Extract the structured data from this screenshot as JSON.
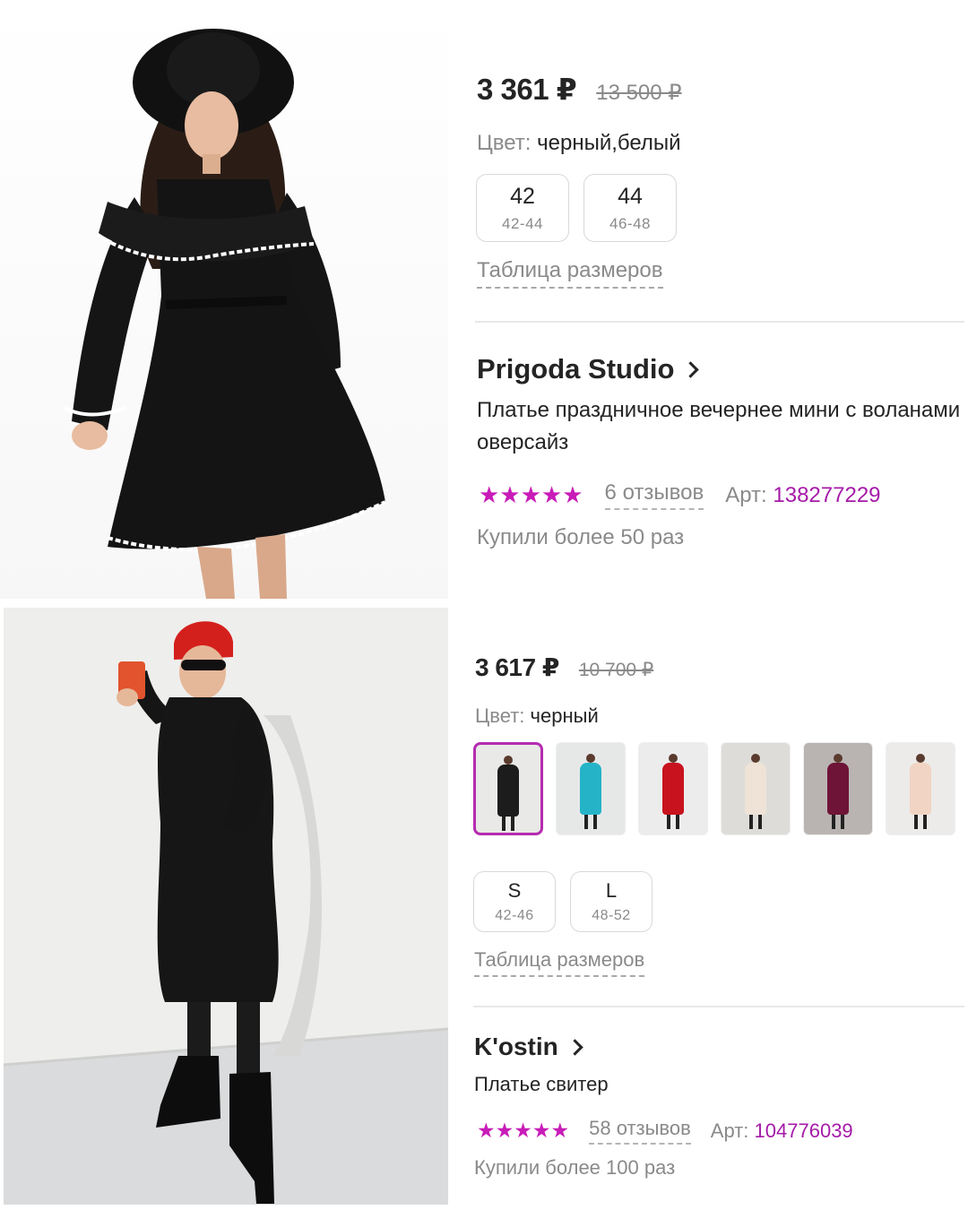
{
  "products": [
    {
      "price": "3 361 ₽",
      "old_price": "13 500 ₽",
      "color_label": "Цвет:",
      "color_value": "черный,белый",
      "sizes": [
        {
          "main": "42",
          "sub": "42-44"
        },
        {
          "main": "44",
          "sub": "46-48"
        }
      ],
      "size_table": "Таблица размеров",
      "brand": "Prigoda Studio",
      "description": [
        "Платье праздничное вечернее мини с воланами",
        "оверсайз"
      ],
      "stars": "★★★★★",
      "reviews": "6 отзывов",
      "art_label": "Арт:",
      "art_number": "138277229",
      "bought": "Купили более 50 раз"
    },
    {
      "price": "3 617 ₽",
      "old_price": "10 700 ₽",
      "color_label": "Цвет:",
      "color_value": "черный",
      "swatches": [
        {
          "dress": "#1c1c1c",
          "bg": "#e9e9e7",
          "selected": true
        },
        {
          "dress": "#25b3c8",
          "bg": "#e6e8e8",
          "selected": false
        },
        {
          "dress": "#c8121e",
          "bg": "#ececec",
          "selected": false
        },
        {
          "dress": "#eee3d6",
          "bg": "#dedcd8",
          "selected": false
        },
        {
          "dress": "#6e1437",
          "bg": "#b9b4b2",
          "selected": false
        },
        {
          "dress": "#f1d4c4",
          "bg": "#ecebea",
          "selected": false
        }
      ],
      "sizes": [
        {
          "main": "S",
          "sub": "42-46"
        },
        {
          "main": "L",
          "sub": "48-52"
        }
      ],
      "size_table": "Таблица размеров",
      "brand": "K'ostin",
      "description": [
        "Платье свитер"
      ],
      "stars": "★★★★★",
      "reviews": "58 отзывов",
      "art_label": "Арт:",
      "art_number": "104776039",
      "bought": "Купили более 100 раз"
    }
  ],
  "colors": {
    "accent": "#c81cb8",
    "art_number": "#a51aa8",
    "text": "#242424",
    "muted": "#8a8a8a",
    "selected_border": "#b52bb0"
  }
}
